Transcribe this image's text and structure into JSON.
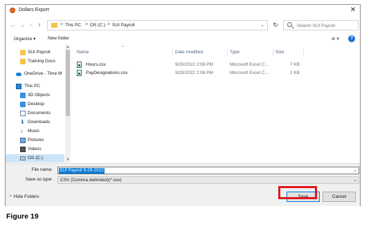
{
  "window": {
    "title": "Dollars Export",
    "close_glyph": "✕"
  },
  "navigation": {
    "back_glyph": "←",
    "forward_glyph": "→",
    "recent_glyph": "⌄",
    "up_glyph": "↑",
    "breadcrumbs": [
      "This PC",
      "OS (C:)",
      "SUI Payroll"
    ],
    "breadcrumb_separator": ">",
    "refresh_glyph": "↻",
    "search_placeholder": "Search SUI Payroll"
  },
  "toolbar": {
    "organize_label": "Organize ▾",
    "new_folder_label": "New folder",
    "view_glyph": "≣ ▾",
    "help_glyph": "?"
  },
  "sidebar": {
    "items": [
      {
        "label": "SUI Payroll",
        "icon": "folder-icon"
      },
      {
        "label": "Training Docs",
        "icon": "folder-icon"
      },
      {
        "label": "OneDrive - Time M",
        "icon": "onedrive-icon"
      },
      {
        "label": "This PC",
        "icon": "pc-icon"
      },
      {
        "label": "3D Objects",
        "icon": "3d-objects-icon"
      },
      {
        "label": "Desktop",
        "icon": "desktop-icon"
      },
      {
        "label": "Documents",
        "icon": "documents-icon"
      },
      {
        "label": "Downloads",
        "icon": "downloads-icon"
      },
      {
        "label": "Music",
        "icon": "music-icon"
      },
      {
        "label": "Pictures",
        "icon": "pictures-icon"
      },
      {
        "label": "Videos",
        "icon": "videos-icon"
      },
      {
        "label": "OS (C:)",
        "icon": "drive-icon"
      }
    ]
  },
  "file_list": {
    "columns": [
      "Name",
      "Date modified",
      "Type",
      "Size"
    ],
    "files": [
      {
        "name": "Hours.csv",
        "date": "9/29/2022 2:08 PM",
        "type": "Microsoft Excel C...",
        "size": "7 KB"
      },
      {
        "name": "PayDesignations.csv",
        "date": "9/29/2022 2:08 PM",
        "type": "Microsoft Excel C...",
        "size": "2 KB"
      }
    ]
  },
  "save_form": {
    "file_name_label": "File name:",
    "file_name_value": "SUI Payroll 9-29-2022",
    "save_as_type_label": "Save as type:",
    "save_as_type_value": "CSV (Comma delimited)(*.csv)"
  },
  "footer": {
    "hide_folders_label": "Hide Folders",
    "save_label": "Save",
    "cancel_label": "Cancel"
  },
  "highlight_color": "#e0151c",
  "caption": "Figure 19"
}
